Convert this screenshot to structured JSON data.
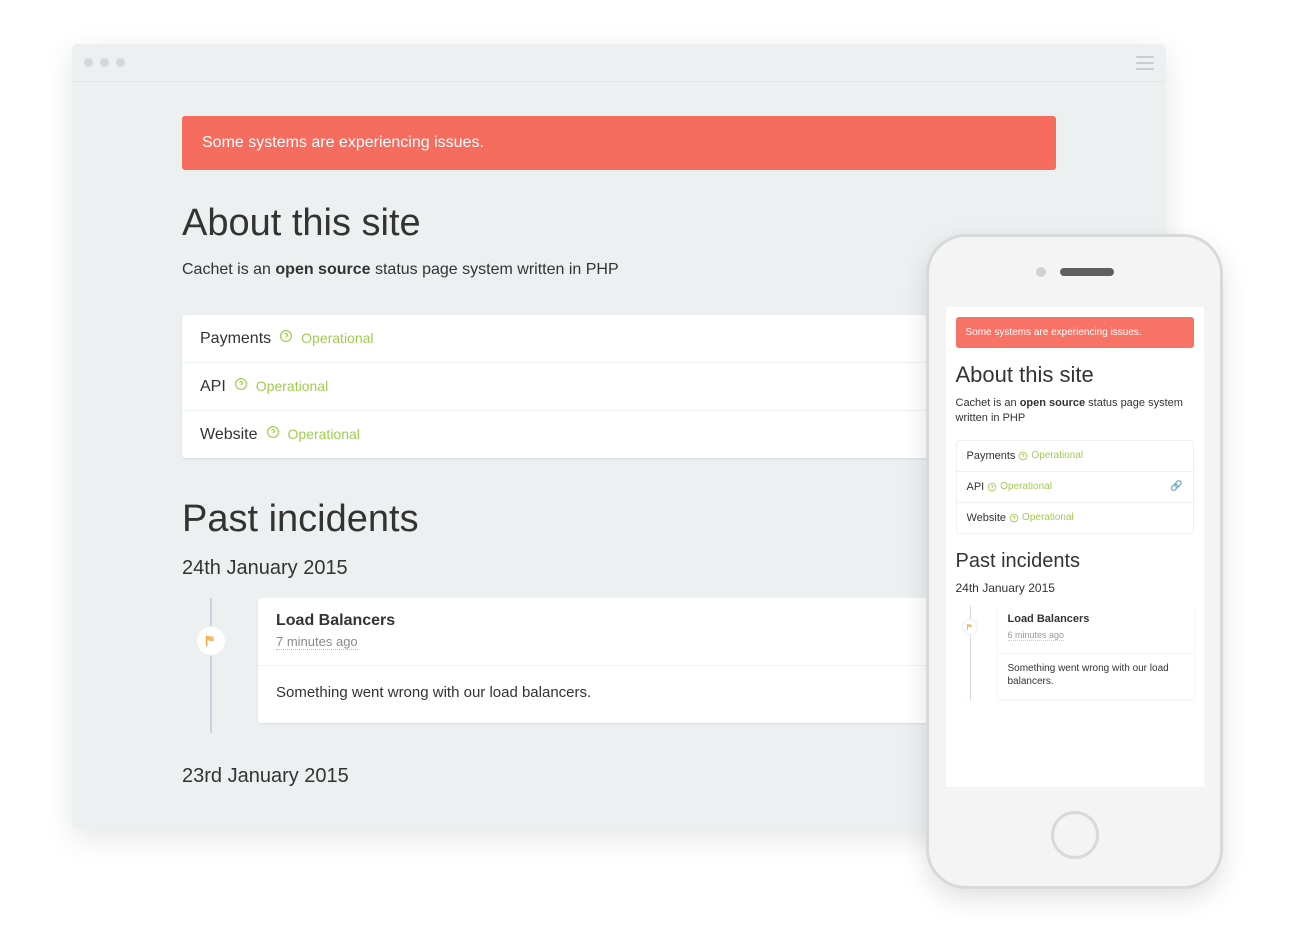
{
  "banner": {
    "message": "Some systems are experiencing issues.",
    "color": "#f66c5e"
  },
  "about": {
    "heading": "About this site",
    "prefix": "Cachet is an ",
    "bold": "open source",
    "suffix": " status page system written in PHP"
  },
  "components": [
    {
      "name": "Payments",
      "status": "Operational",
      "has_link": false
    },
    {
      "name": "API",
      "status": "Operational",
      "has_link": true
    },
    {
      "name": "Website",
      "status": "Operational",
      "has_link": false
    }
  ],
  "incidents": {
    "heading": "Past incidents",
    "days": [
      {
        "date_label": "24th January 2015",
        "items": [
          {
            "title": "Load Balancers",
            "time_ago": "7 minutes ago",
            "body": "Something went wrong with our load balancers."
          }
        ]
      },
      {
        "date_label": "23rd January 2015",
        "items": []
      }
    ]
  },
  "phone": {
    "banner": "Some systems are experiencing issues.",
    "about_heading": "About this site",
    "about_prefix": "Cachet is an ",
    "about_bold": "open source",
    "about_suffix": " status page system written in PHP",
    "components": [
      {
        "name": "Payments",
        "status": "Operational",
        "has_link": false
      },
      {
        "name": "API",
        "status": "Operational",
        "has_link": true
      },
      {
        "name": "Website",
        "status": "Operational",
        "has_link": false
      }
    ],
    "incidents_heading": "Past incidents",
    "date_label": "24th January 2015",
    "incident_title": "Load Balancers",
    "incident_time": "6 minutes ago",
    "incident_body": "Something went wrong with our load balancers."
  }
}
